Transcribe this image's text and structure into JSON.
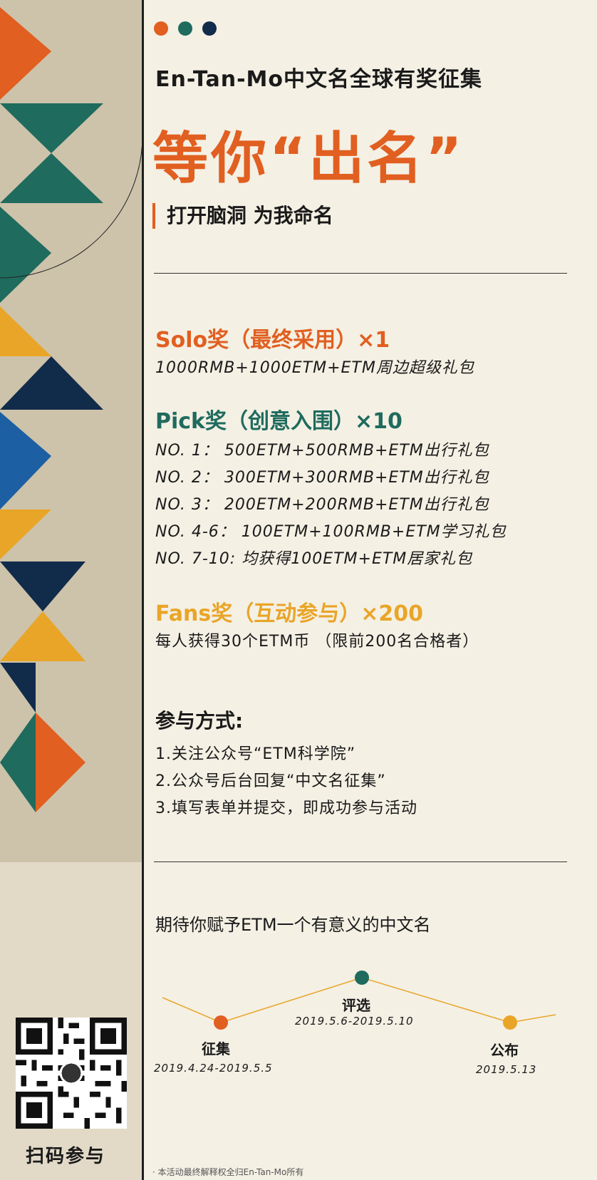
{
  "colors": {
    "orange": "#e15f20",
    "teal": "#1f6b5e",
    "navy": "#112b4a",
    "blue": "#1c5fa3",
    "yellow": "#e9a528",
    "bg": "#f4f0e4",
    "panel": "#cdc3aa"
  },
  "header": {
    "subtitle": "En-Tan-Mo中文名全球有奖征集",
    "title": "等你“出名”",
    "slogan": "打开脑洞 为我命名"
  },
  "prizes": {
    "solo": {
      "heading": "Solo奖（最终采用）×1",
      "lines": [
        "1000RMB+1000ETM+ETM周边超级礼包"
      ]
    },
    "pick": {
      "heading": "Pick奖（创意入围）×10",
      "lines": [
        "NO. 1：  500ETM+500RMB+ETM出行礼包",
        "NO. 2：  300ETM+300RMB+ETM出行礼包",
        "NO. 3：  200ETM+200RMB+ETM出行礼包",
        "NO. 4-6：  100ETM+100RMB+ETM学习礼包",
        "NO. 7-10: 均获得100ETM+ETM居家礼包"
      ]
    },
    "fans": {
      "heading": "Fans奖（互动参与）×200",
      "lines": [
        "每人获得30个ETM币 （限前200名合格者）"
      ]
    }
  },
  "join": {
    "heading": "参与方式:",
    "steps": [
      "1.关注公众号“ETM科学院”",
      "2.公众号后台回复“中文名征集”",
      "3.填写表单并提交，即成功参与活动"
    ]
  },
  "closing": "期待你赋予ETM一个有意义的中文名",
  "timeline": [
    {
      "label": "征集",
      "date": "2019.4.24-2019.5.5",
      "color": "#e15f20"
    },
    {
      "label": "评选",
      "date": "2019.5.6-2019.5.10",
      "color": "#1f6b5e"
    },
    {
      "label": "公布",
      "date": "2019.5.13",
      "color": "#e9a528"
    }
  ],
  "qr": {
    "icon": "qr-code",
    "caption": "扫码参与"
  },
  "footer": "· 本活动最终解释权全归En-Tan-Mo所有"
}
